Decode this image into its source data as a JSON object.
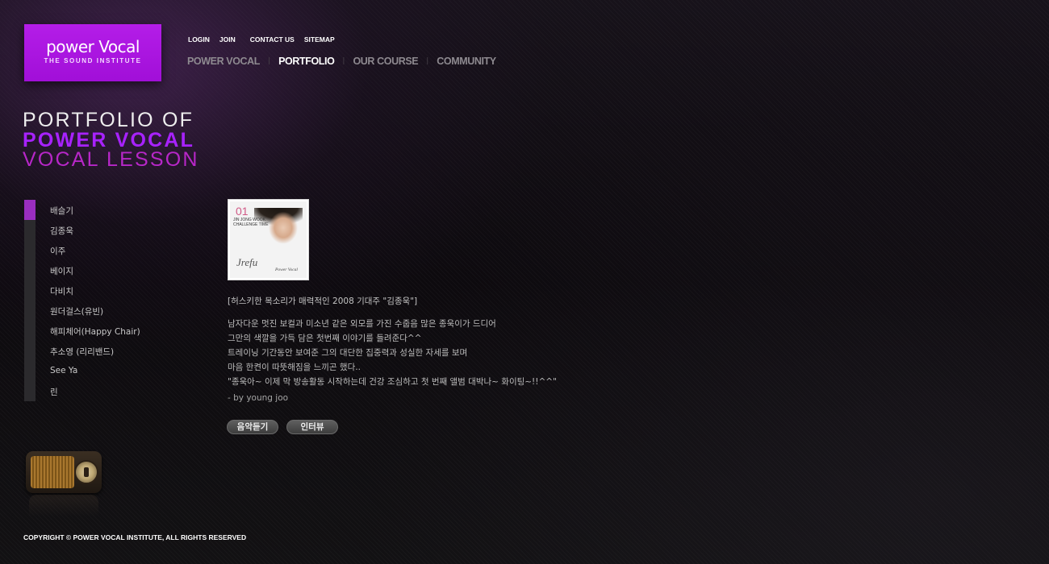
{
  "brand": {
    "logo_main": "power Vocal",
    "logo_sub": "THE SOUND INSTITUTE"
  },
  "util_nav": [
    "LOGIN",
    "JOIN",
    "CONTACT US",
    "SITEMAP"
  ],
  "main_nav": [
    {
      "label": "POWER VOCAL",
      "active": false
    },
    {
      "label": "PORTFOLIO",
      "active": true
    },
    {
      "label": "OUR COURSE",
      "active": false
    },
    {
      "label": "COMMUNITY",
      "active": false
    }
  ],
  "hero": {
    "line1": "PORTFOLIO OF",
    "line2": "POWER VOCAL",
    "line3": "VOCAL LESSON"
  },
  "sidebar": {
    "items": [
      {
        "label": "배슬기",
        "active": true
      },
      {
        "label": "김종욱",
        "active": false
      },
      {
        "label": "이주",
        "active": false
      },
      {
        "label": "베이지",
        "active": false
      },
      {
        "label": "다비치",
        "active": false
      },
      {
        "label": "원더걸스(유빈)",
        "active": false
      },
      {
        "label": "해피체어(Happy Chair)",
        "active": false
      },
      {
        "label": "추소영 (리리밴드)",
        "active": false
      },
      {
        "label": "See Ya",
        "active": false
      },
      {
        "label": "린",
        "active": false
      }
    ]
  },
  "album": {
    "number": "01",
    "title_line1": "JIN JONG WOOK",
    "title_line2": "CHALLENGE TIME",
    "signature": "Jrefu",
    "brand": "Power Vocal"
  },
  "content": {
    "headline": "[허스키한 목소리가 매력적인 2008 기대주 \"김종욱\"]",
    "lines": [
      "남자다운 멋진 보컬과 미소년 같은 외모를 가진 수줍음 많은 종욱이가 드디어",
      "그만의 색깔을 가득 담은 첫번째 이야기를 들려준다^^",
      "트레이닝 기간동안 보여준 그의 대단한 집중력과 성실한 자세를 보며",
      "마음 한켠이 따뜻해짐을 느끼곤 했다..",
      "\"종욱아~ 이제 막 방송활동 시작하는데 건강 조심하고 첫 번째 앨범 대박나~ 화이팅~!!^^\""
    ],
    "byline": "- by young joo"
  },
  "buttons": {
    "listen": "음악듣기",
    "interview": "인터뷰"
  },
  "footer": {
    "copyright": "COPYRIGHT © POWER VOCAL INSTITUTE, ALL RIGHTS RESERVED"
  },
  "colors": {
    "brand_purple": "#a10fd8",
    "hero_purple": "#a822ff",
    "hero_magenta": "#b727c8",
    "sidebar_active": "#9a2ec0"
  }
}
